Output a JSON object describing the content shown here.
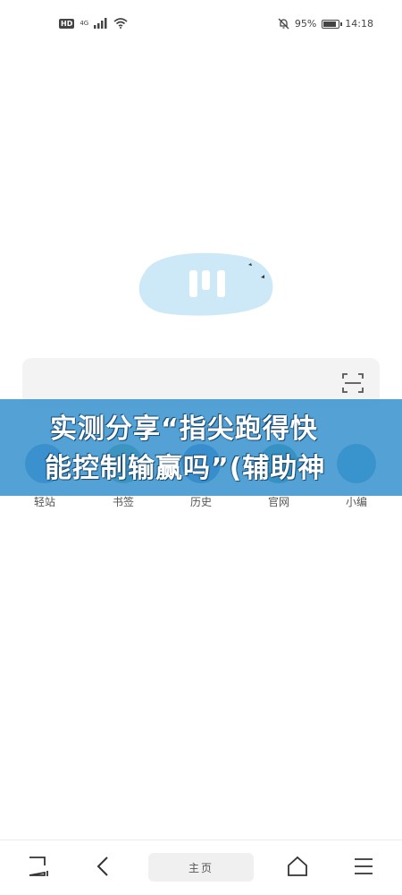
{
  "status_bar": {
    "hd": "HD",
    "network": "4G",
    "battery_percent": "95%",
    "battery_level": 0.95,
    "time": "14:18"
  },
  "logo": {
    "name": "browser-logo",
    "color": "#cde8f6",
    "mark_color": "#ffffff"
  },
  "search": {
    "scan_icon": "scan-icon"
  },
  "quick_links": [
    {
      "label": "轻站",
      "color": "#3b7fc9"
    },
    {
      "label": "书签",
      "color": "#4c9a6b"
    },
    {
      "label": "历史",
      "color": "#2f6db8"
    },
    {
      "label": "官网",
      "color": "#1f8a7a"
    },
    {
      "label": "小编",
      "color": "#3a8bbd"
    }
  ],
  "banner": {
    "line1": "实测分享“指尖跑得快",
    "line2": "能控制输赢吗”(辅助神",
    "background": "#3a94ce"
  },
  "bottom_nav": {
    "home_label": "主页",
    "icons": [
      "tabs-icon",
      "back-icon",
      "home-icon",
      "menu-icon"
    ]
  }
}
